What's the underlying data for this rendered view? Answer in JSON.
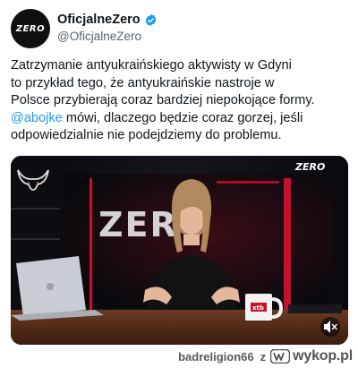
{
  "post": {
    "display_name": "OficjalneZero",
    "handle": "@OficjalneZero",
    "avatar_text": "ZERO",
    "verified": true,
    "text_lines": [
      "Zatrzymanie antyukraińskiego aktywisty w Gdyni",
      "to przykład tego, że antyukraińskie nastroje w",
      "Polsce przybierają coraz bardziej niepokojące formy."
    ],
    "mention": "@abojke",
    "text_after_mention": " mówi, dlaczego będzie coraz gorzej, jeśli",
    "text_last_line": "odpowiedzialnie nie podejdziemy do problemu."
  },
  "video": {
    "watermark": "ZERO",
    "backdrop_text": "ZERO",
    "mug_brand": "xtb",
    "mute_icon": "speaker-muted-icon"
  },
  "footer": {
    "user": "badreligion66",
    "separator": "z",
    "brand": "wykop.pl"
  },
  "colors": {
    "link": "#1d9bf0",
    "verified": "#1d9bf0",
    "studio_red": "#c8102e"
  }
}
